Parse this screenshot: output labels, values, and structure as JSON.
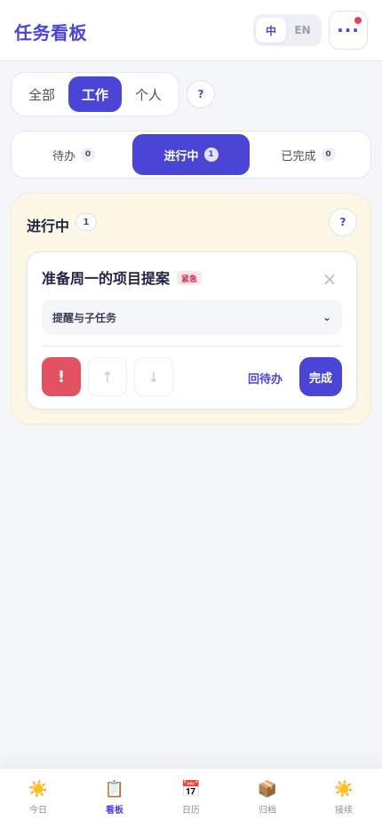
{
  "header": {
    "title": "任务看板",
    "lang_zh": "中",
    "lang_en": "EN",
    "more_label": "···"
  },
  "filters": {
    "items": [
      {
        "label": "全部"
      },
      {
        "label": "工作",
        "active": true
      },
      {
        "label": "个人"
      }
    ],
    "help": "?"
  },
  "status_tabs": [
    {
      "label": "待办",
      "count": "0"
    },
    {
      "label": "进行中",
      "count": "1",
      "active": true
    },
    {
      "label": "已完成",
      "count": "0"
    }
  ],
  "column": {
    "title": "进行中",
    "count": "1",
    "help": "?",
    "task": {
      "title": "准备周一的项目提案",
      "badge": "紧急",
      "close": "×",
      "subtasks_label": "提醒与子任务",
      "subtasks_chevron": "⌄",
      "priority_label": "!",
      "up_arrow": "↑",
      "down_arrow": "↓",
      "back_label": "回待办",
      "done_label": "完成"
    }
  },
  "bottom_nav": [
    {
      "label": "今日",
      "icon": "☀️",
      "icon_name": "sun-icon"
    },
    {
      "label": "看板",
      "icon": "📋",
      "icon_name": "clipboard-icon",
      "active": true
    },
    {
      "label": "日历",
      "icon": "📅",
      "icon_name": "calendar-icon"
    },
    {
      "label": "归档",
      "icon": "📦",
      "icon_name": "box-icon"
    },
    {
      "label": "接续",
      "icon": "☀️",
      "icon_name": "sun-icon"
    }
  ],
  "colors": {
    "accent": "#4b45d6",
    "urgent": "#e25263",
    "column_bg": "#fdf8e6",
    "notification": "#e0435a"
  }
}
